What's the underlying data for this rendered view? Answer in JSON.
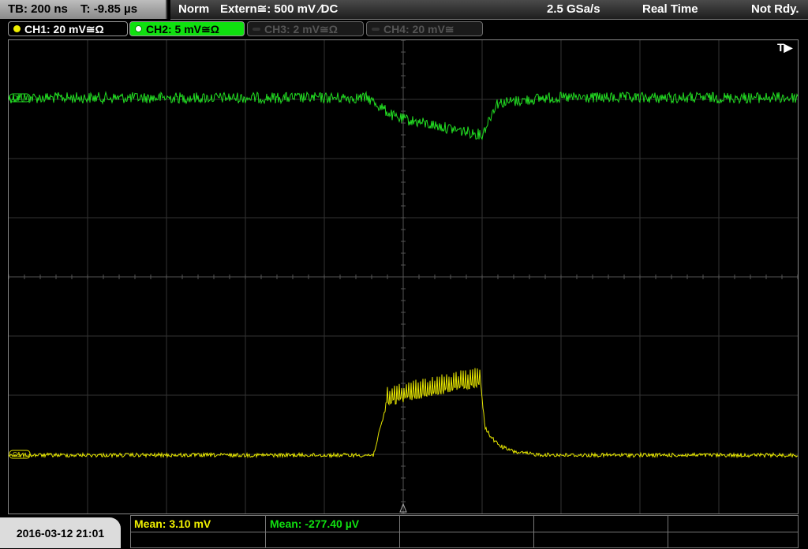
{
  "status": {
    "timebase": "TB: 200 ns",
    "trigger_time": "T: -9.85 µs",
    "mode": "Norm",
    "trigger_source": "Extern≅: 500 mV ∕DC",
    "sample_rate": "2.5 GSa/s",
    "acq_mode": "Real Time",
    "state": "Not Rdy."
  },
  "channels": [
    {
      "label": "CH1: 20 mV≅Ω",
      "color": "#f0f000",
      "active": true
    },
    {
      "label": "CH2: 5 mV≅Ω",
      "color": "#10e010",
      "active": true
    },
    {
      "label": "CH3: 2 mV≅Ω",
      "color": "#555555",
      "active": false
    },
    {
      "label": "CH4: 20 mV≅",
      "color": "#555555",
      "active": false
    }
  ],
  "plot": {
    "trigger_marker": "T▶",
    "ch1_marker": "C1",
    "ch2_marker": "C2",
    "grid_divisions": {
      "x": 10,
      "y": 8
    }
  },
  "footer": {
    "datetime": "2016-03-12 21:01",
    "measurements": [
      {
        "label": "Mean: 3.10 mV",
        "color": "#f0f000"
      },
      {
        "label": "Mean: -277.40 µV",
        "color": "#10e010"
      }
    ]
  }
}
